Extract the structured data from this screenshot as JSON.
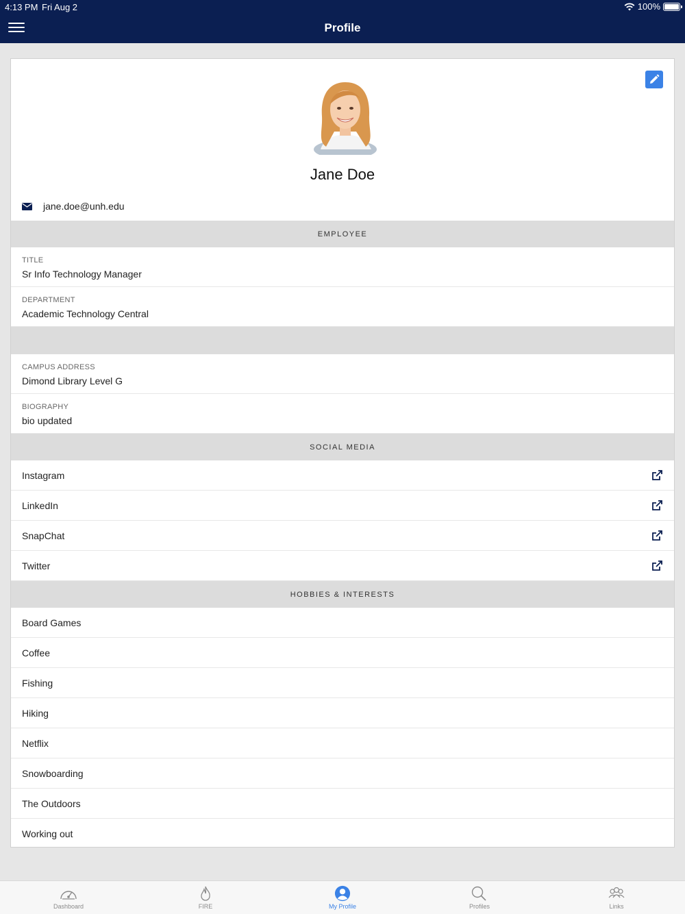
{
  "status_bar": {
    "time": "4:13 PM",
    "date": "Fri Aug 2",
    "battery": "100%"
  },
  "nav": {
    "title": "Profile"
  },
  "profile": {
    "name": "Jane Doe",
    "email": "jane.doe@unh.edu"
  },
  "employee": {
    "header": "EMPLOYEE",
    "fields": [
      {
        "label": "TITLE",
        "value": "Sr Info Technology Manager"
      },
      {
        "label": "DEPARTMENT",
        "value": "Academic Technology Central"
      }
    ]
  },
  "personal": {
    "fields": [
      {
        "label": "CAMPUS ADDRESS",
        "value": "Dimond Library Level G"
      },
      {
        "label": "BIOGRAPHY",
        "value": "bio updated"
      }
    ]
  },
  "social": {
    "header": "SOCIAL MEDIA",
    "items": [
      "Instagram",
      "LinkedIn",
      "SnapChat",
      "Twitter"
    ]
  },
  "hobbies": {
    "header": "HOBBIES & INTERESTS",
    "items": [
      "Board Games",
      "Coffee",
      "Fishing",
      "Hiking",
      "Netflix",
      "Snowboarding",
      "The Outdoors",
      "Working out"
    ]
  },
  "tabs": [
    {
      "label": "Dashboard",
      "icon": "speedometer-icon"
    },
    {
      "label": "FIRE",
      "icon": "flame-icon"
    },
    {
      "label": "My Profile",
      "icon": "user-icon",
      "active": true
    },
    {
      "label": "Profiles",
      "icon": "search-icon"
    },
    {
      "label": "Links",
      "icon": "people-icon"
    }
  ],
  "colors": {
    "nav_bg": "#0b1f52",
    "accent": "#3b82e6",
    "section_bg": "#dcdcdc"
  }
}
